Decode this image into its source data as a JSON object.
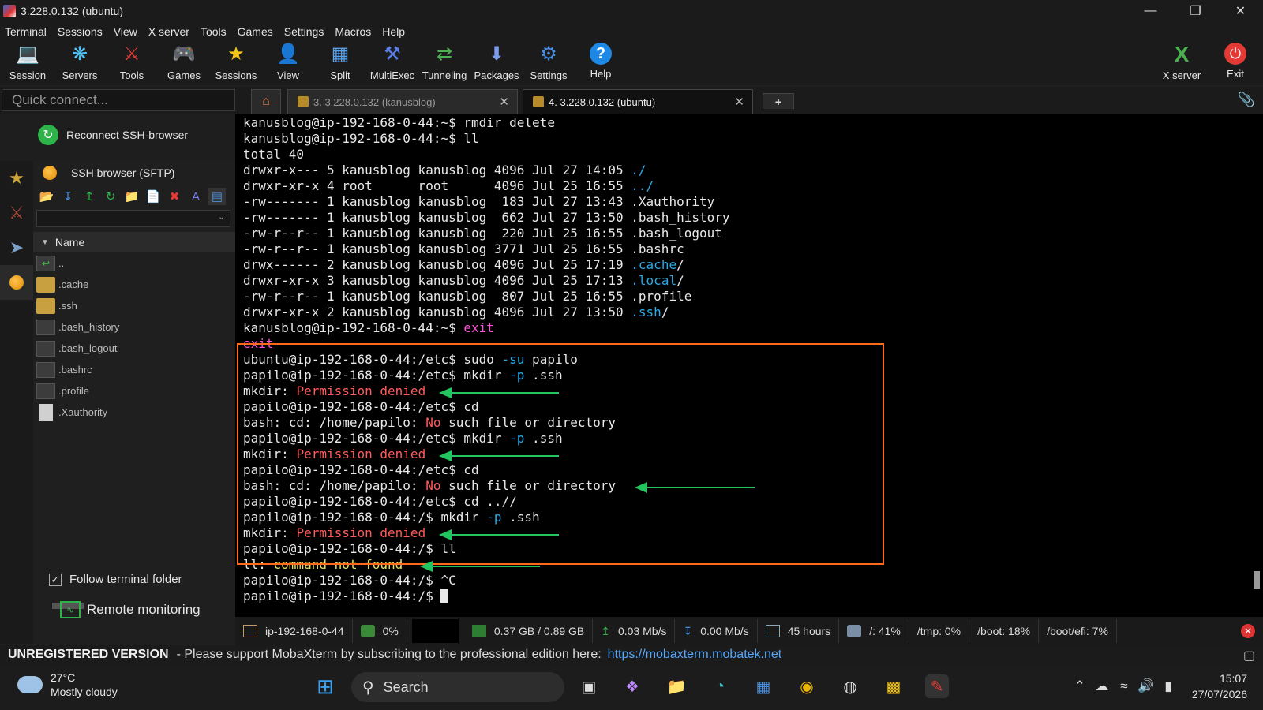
{
  "window": {
    "title": "3.228.0.132 (ubuntu)"
  },
  "menu": [
    "Terminal",
    "Sessions",
    "View",
    "X server",
    "Tools",
    "Games",
    "Settings",
    "Macros",
    "Help"
  ],
  "toolbar": {
    "session": "Session",
    "servers": "Servers",
    "tools": "Tools",
    "games": "Games",
    "sessions": "Sessions",
    "view": "View",
    "split": "Split",
    "multiexec": "MultiExec",
    "tunneling": "Tunneling",
    "packages": "Packages",
    "settings": "Settings",
    "help": "Help",
    "xserver": "X server",
    "exit": "Exit"
  },
  "quick_connect": {
    "placeholder": "Quick connect..."
  },
  "tabs": [
    {
      "label": "3. 3.228.0.132 (kanusblog)"
    },
    {
      "label": "4. 3.228.0.132 (ubuntu)"
    }
  ],
  "sidebar": {
    "reconnect": "Reconnect SSH-browser",
    "sftp_title": "SSH browser (SFTP)",
    "column_name": "Name",
    "files": [
      "..",
      ".cache",
      ".ssh",
      ".bash_history",
      ".bash_logout",
      ".bashrc",
      ".profile",
      ".Xauthority"
    ],
    "follow_folder": "Follow terminal folder",
    "remote_monitoring": "Remote monitoring"
  },
  "terminal": {
    "l01": "kanusblog@ip-192-168-0-44:~$ rmdir delete",
    "l02": "kanusblog@ip-192-168-0-44:~$ ll",
    "l03": "total 40",
    "l04": "drwxr-x--- 5 kanusblog kanusblog 4096 Jul 27 14:05 ",
    "l04b": "./",
    "l05": "drwxr-xr-x 4 root      root      4096 Jul 25 16:55 ",
    "l05b": "../",
    "l06": "-rw------- 1 kanusblog kanusblog  183 Jul 27 13:43 .Xauthority",
    "l07": "-rw------- 1 kanusblog kanusblog  662 Jul 27 13:50 .bash_history",
    "l08": "-rw-r--r-- 1 kanusblog kanusblog  220 Jul 25 16:55 .bash_logout",
    "l09": "-rw-r--r-- 1 kanusblog kanusblog 3771 Jul 25 16:55 .bashrc",
    "l10": "drwx------ 2 kanusblog kanusblog 4096 Jul 25 17:19 ",
    "l10b": ".cache",
    "l11": "drwxr-xr-x 3 kanusblog kanusblog 4096 Jul 25 17:13 ",
    "l11b": ".local",
    "l12": "-rw-r--r-- 1 kanusblog kanusblog  807 Jul 25 16:55 .profile",
    "l13": "drwxr-xr-x 2 kanusblog kanusblog 4096 Jul 27 13:50 ",
    "l13b": ".ssh",
    "slash": "/",
    "l14a": "kanusblog@ip-192-168-0-44:~$ ",
    "l14b": "exit",
    "l15": "exit",
    "l16a": "ubuntu@ip-192-168-0-44:/etc$ sudo ",
    "l16b": "-su",
    "l16c": " papilo",
    "l17a": "papilo@ip-192-168-0-44:/etc$ mkdir ",
    "l17b": "-p",
    "l17c": " .ssh",
    "mkdir": "mkdir: ",
    "perm": "Permission denied",
    "l19": "papilo@ip-192-168-0-44:/etc$ cd",
    "l20a": "bash: cd: /home/papilo: ",
    "l20b": "No",
    "l20c": " such file or directory",
    "l24": "papilo@ip-192-168-0-44:/etc$ cd ..//",
    "l25a": "papilo@ip-192-168-0-44:/$ mkdir ",
    "l25b": "-p",
    "l25c": " .ssh",
    "l27": "papilo@ip-192-168-0-44:/$ ll",
    "l28a": "ll: ",
    "l28b": "command not found",
    "l29": "papilo@ip-192-168-0-44:/$ ^C",
    "l30": "papilo@ip-192-168-0-44:/$ "
  },
  "status": {
    "host": "ip-192-168-0-44",
    "cpu": "0%",
    "mem": "0.37 GB / 0.89 GB",
    "up": "0.03 Mb/s",
    "down": "0.00 Mb/s",
    "uptime": "45 hours",
    "disk_root": "/: 41%",
    "disk_tmp": "/tmp: 0%",
    "disk_boot": "/boot: 18%",
    "disk_efi": "/boot/efi: 7%"
  },
  "unregistered": {
    "label": "UNREGISTERED VERSION",
    "message": "-  Please support MobaXterm by subscribing to the professional edition here:",
    "link": "https://mobaxterm.mobatek.net"
  },
  "taskbar": {
    "temp": "27°C",
    "weather": "Mostly cloudy",
    "search": "Search",
    "time": "15:07",
    "date": "27/07/2026"
  },
  "colors": {
    "highlight_box": "#ff6a1a",
    "arrow": "#22c55e",
    "cyan": "#2aa9e6",
    "error_red": "#ff5a5a"
  }
}
